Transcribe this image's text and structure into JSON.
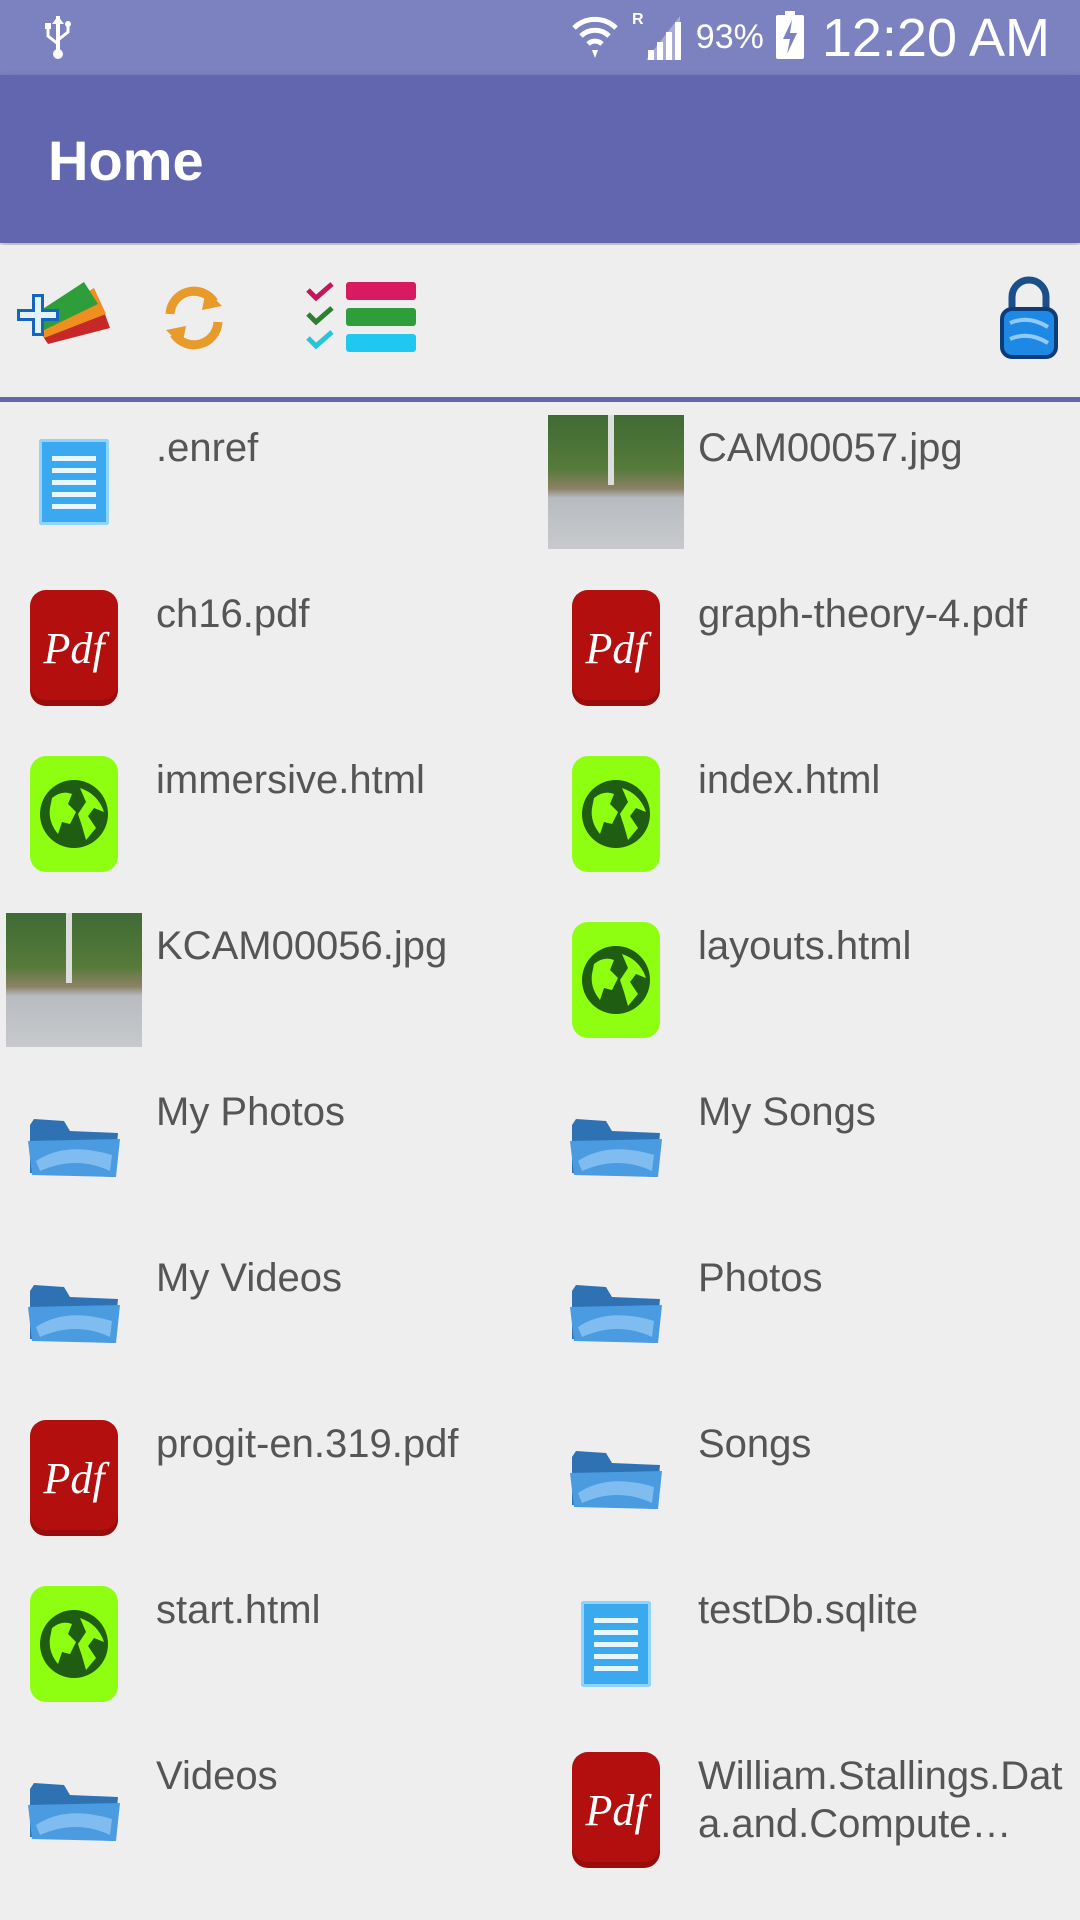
{
  "status_bar": {
    "battery": "93%",
    "time": "12:20 AM",
    "icons": [
      "usb-icon",
      "wifi-icon",
      "roaming-signal-icon",
      "battery-charging-icon"
    ]
  },
  "app_bar": {
    "title": "Home"
  },
  "toolbar": {
    "icons": [
      "add-files-icon",
      "refresh-icon",
      "checklist-icon",
      "lock-icon"
    ]
  },
  "files": [
    {
      "name": ".enref",
      "type": "doc"
    },
    {
      "name": "CAM00057.jpg",
      "type": "image"
    },
    {
      "name": "ch16.pdf",
      "type": "pdf"
    },
    {
      "name": "graph-theory-4.pdf",
      "type": "pdf"
    },
    {
      "name": "immersive.html",
      "type": "html"
    },
    {
      "name": "index.html",
      "type": "html"
    },
    {
      "name": "KCAM00056.jpg",
      "type": "image"
    },
    {
      "name": "layouts.html",
      "type": "html"
    },
    {
      "name": "My Photos",
      "type": "folder"
    },
    {
      "name": "My Songs",
      "type": "folder"
    },
    {
      "name": "My Videos",
      "type": "folder"
    },
    {
      "name": "Photos",
      "type": "folder"
    },
    {
      "name": "progit-en.319.pdf",
      "type": "pdf"
    },
    {
      "name": "Songs",
      "type": "folder"
    },
    {
      "name": "start.html",
      "type": "html"
    },
    {
      "name": "testDb.sqlite",
      "type": "doc"
    },
    {
      "name": "Videos",
      "type": "folder"
    },
    {
      "name": "William.Stallings.Data.and.Compute…",
      "type": "pdf"
    }
  ],
  "pdf_label": "Pdf",
  "colors": {
    "status_bar": "#7b82bf",
    "app_bar": "#6166ae",
    "background": "#eeeeee",
    "pdf": "#b30f0f",
    "web": "#8fff12",
    "folder": "#3a86c8"
  }
}
